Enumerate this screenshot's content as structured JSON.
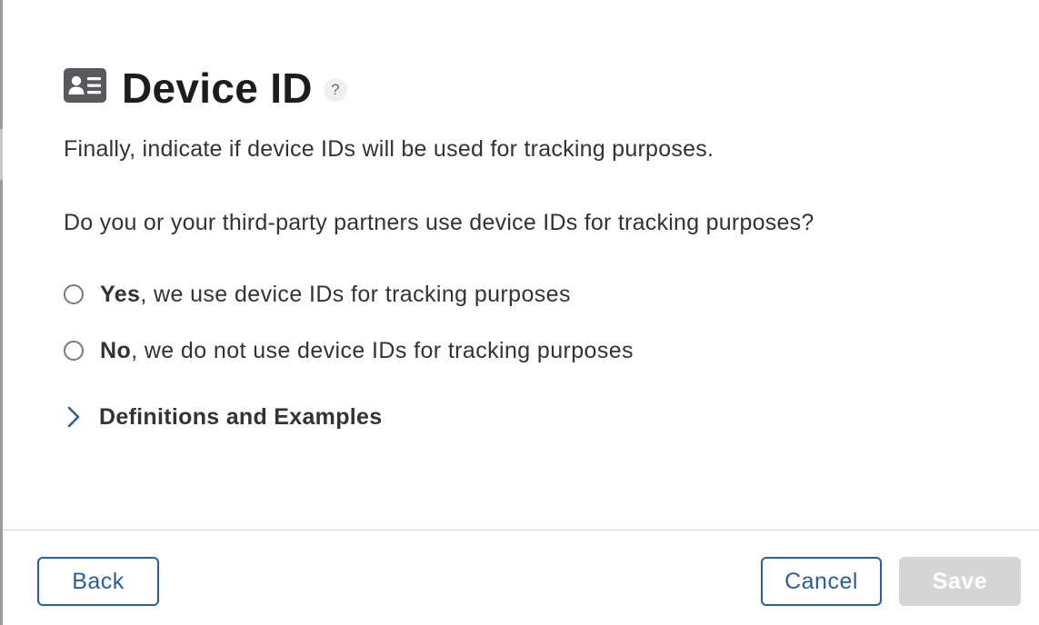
{
  "header": {
    "title": "Device ID",
    "help_label": "?"
  },
  "intro_text": "Finally, indicate if device IDs will be used for tracking purposes.",
  "question": "Do you or your third-party partners use device IDs for tracking purposes?",
  "options": [
    {
      "bold": "Yes",
      "rest": ", we use device IDs for tracking purposes",
      "selected": false
    },
    {
      "bold": "No",
      "rest": ", we do not use device IDs for tracking purposes",
      "selected": false
    }
  ],
  "disclosure": {
    "label": "Definitions and Examples",
    "expanded": false
  },
  "footer": {
    "back_label": "Back",
    "cancel_label": "Cancel",
    "save_label": "Save",
    "save_enabled": false
  },
  "icons": {
    "title_icon": "id-card-icon",
    "disclosure_icon": "chevron-right-icon"
  },
  "colors": {
    "accent": "#2c5e9b",
    "text": "#333333",
    "title": "#1d1d1f",
    "icon": "#58585d",
    "disabled_button": "#d6d6d6"
  }
}
